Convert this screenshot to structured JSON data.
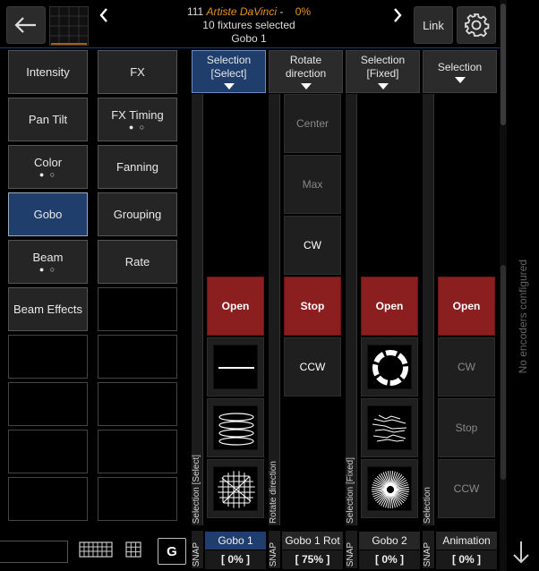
{
  "header": {
    "fixture_num": "111",
    "fixture_name": "Artiste DaVinci",
    "dash": "-",
    "percent": "0%",
    "selected": "10 fixtures selected",
    "current": "Gobo 1",
    "link_label": "Link"
  },
  "categories": [
    {
      "label": "Intensity",
      "dots": ""
    },
    {
      "label": "FX",
      "dots": ""
    },
    {
      "label": "Pan Tilt",
      "dots": ""
    },
    {
      "label": "FX Timing",
      "dots": "● ○"
    },
    {
      "label": "Color",
      "dots": "● ○"
    },
    {
      "label": "Fanning",
      "dots": ""
    },
    {
      "label": "Gobo",
      "dots": ""
    },
    {
      "label": "Grouping",
      "dots": ""
    },
    {
      "label": "Beam",
      "dots": "● ○"
    },
    {
      "label": "Rate",
      "dots": ""
    },
    {
      "label": "Beam Effects",
      "dots": ""
    }
  ],
  "columns": [
    {
      "header": "Selection\n[Select]",
      "strip": "Selection [Select]",
      "footer": "Gobo 1",
      "value": "[ 0% ]",
      "slots": [
        "",
        "",
        "",
        "",
        "Open",
        "gobo-line",
        "gobo-ellipses",
        "gobo-grid"
      ]
    },
    {
      "header": "Rotate\ndirection",
      "strip": "Rotate direction",
      "footer": "Gobo 1 Rot",
      "value": "[ 75% ]",
      "slots": [
        "",
        "Center",
        "Max",
        "CW",
        "Stop",
        "CCW",
        "",
        ""
      ]
    },
    {
      "header": "Selection\n[Fixed]",
      "strip": "Selection [Fixed]",
      "footer": "Gobo 2",
      "value": "[ 0% ]",
      "slots": [
        "",
        "",
        "",
        "",
        "Open",
        "gobo-ring",
        "gobo-scribble",
        "gobo-burst"
      ]
    },
    {
      "header": "Selection",
      "strip": "Selection",
      "footer": "Animation",
      "value": "[ 0% ]",
      "slots": [
        "",
        "",
        "",
        "",
        "Open",
        "CW",
        "Stop",
        "CCW"
      ]
    }
  ],
  "snap_label": "SNAP",
  "side_message": "No encoders configured",
  "bottom": {
    "g_label": "G"
  }
}
